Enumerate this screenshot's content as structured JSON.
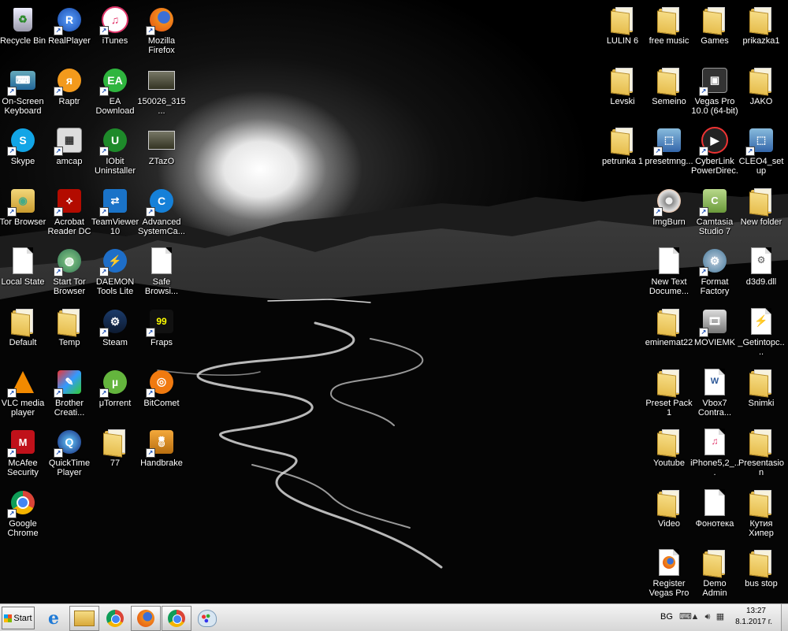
{
  "desktop": {
    "left_icons": [
      {
        "label": "Recycle Bin",
        "icon": "recycle-bin-icon"
      },
      {
        "label": "RealPlayer",
        "icon": "realplayer-icon"
      },
      {
        "label": "iTunes",
        "icon": "itunes-icon"
      },
      {
        "label": "Mozilla Firefox",
        "icon": "firefox-icon"
      },
      {
        "label": "On-Screen Keyboard",
        "icon": "keyboard-icon"
      },
      {
        "label": "Raptr",
        "icon": "raptr-icon"
      },
      {
        "label": "EA Download Manager",
        "icon": "ea-icon"
      },
      {
        "label": "150026_315...",
        "icon": "image-file-icon"
      },
      {
        "label": "Skype",
        "icon": "skype-icon"
      },
      {
        "label": "amcap",
        "icon": "amcap-icon"
      },
      {
        "label": "IObit Uninstaller",
        "icon": "iobit-icon"
      },
      {
        "label": "ZTazO",
        "icon": "image-file-icon"
      },
      {
        "label": "Tor Browser",
        "icon": "tor-icon"
      },
      {
        "label": "Acrobat Reader DC",
        "icon": "acrobat-icon"
      },
      {
        "label": "TeamViewer 10",
        "icon": "teamviewer-icon"
      },
      {
        "label": "Advanced SystemCa...",
        "icon": "advanced-systemcare-icon"
      },
      {
        "label": "Local State",
        "icon": "document-icon"
      },
      {
        "label": "Start Tor Browser",
        "icon": "tor-globe-icon"
      },
      {
        "label": "DAEMON Tools Lite",
        "icon": "daemon-tools-icon"
      },
      {
        "label": "Safe Browsi...",
        "icon": "document-icon"
      },
      {
        "label": "Default",
        "icon": "folder-icon"
      },
      {
        "label": "Temp",
        "icon": "folder-icon"
      },
      {
        "label": "Steam",
        "icon": "steam-icon"
      },
      {
        "label": "Fraps",
        "icon": "fraps-icon"
      },
      {
        "label": "VLC media player",
        "icon": "vlc-icon"
      },
      {
        "label": "Brother Creati...",
        "icon": "brother-icon"
      },
      {
        "label": "μTorrent",
        "icon": "utorrent-icon"
      },
      {
        "label": "BitComet",
        "icon": "bitcomet-icon"
      },
      {
        "label": "McAfee Security Sc...",
        "icon": "mcafee-icon"
      },
      {
        "label": "QuickTime Player",
        "icon": "quicktime-icon"
      },
      {
        "label": "77",
        "icon": "folder-icon"
      },
      {
        "label": "Handbrake",
        "icon": "handbrake-icon"
      },
      {
        "label": "Google Chrome",
        "icon": "chrome-icon"
      }
    ],
    "right_icons": [
      {
        "label": "LULIN 6",
        "icon": "folder-icon"
      },
      {
        "label": "free music",
        "icon": "folder-icon"
      },
      {
        "label": "Games",
        "icon": "folder-icon"
      },
      {
        "label": "prikazka1",
        "icon": "folder-icon"
      },
      {
        "label": "Levski",
        "icon": "folder-icon"
      },
      {
        "label": "Semeino",
        "icon": "folder-icon"
      },
      {
        "label": "Vegas Pro 10.0 (64-bit)",
        "icon": "vegas-icon"
      },
      {
        "label": "JAKO",
        "icon": "folder-icon"
      },
      {
        "label": "petrunka 1",
        "icon": "folder-icon"
      },
      {
        "label": "presetmng...",
        "icon": "installer-icon"
      },
      {
        "label": "CyberLink PowerDirec...",
        "icon": "powerdirector-icon"
      },
      {
        "label": "CLEO4_setup",
        "icon": "installer-icon"
      },
      {
        "label": "ImgBurn",
        "icon": "imgburn-icon"
      },
      {
        "label": "Camtasia Studio 7",
        "icon": "camtasia-icon"
      },
      {
        "label": "New folder",
        "icon": "folder-icon"
      },
      {
        "label": "New Text Docume...",
        "icon": "text-document-icon"
      },
      {
        "label": "Format Factory",
        "icon": "format-factory-icon"
      },
      {
        "label": "d3d9.dll",
        "icon": "dll-icon"
      },
      {
        "label": "eminemat22",
        "icon": "folder-icon"
      },
      {
        "label": "MOVIEMK",
        "icon": "moviemaker-icon"
      },
      {
        "label": "_Getintopc....",
        "icon": "getintopc-icon"
      },
      {
        "label": "Preset Pack 1",
        "icon": "folder-icon"
      },
      {
        "label": "Vbox7 Contra...",
        "icon": "word-document-icon"
      },
      {
        "label": "Snimki",
        "icon": "folder-icon"
      },
      {
        "label": "Youtube",
        "icon": "folder-icon"
      },
      {
        "label": "iPhone5,2_...",
        "icon": "ipsw-icon"
      },
      {
        "label": "Presentasion",
        "icon": "folder-icon"
      },
      {
        "label": "Video",
        "icon": "folder-icon"
      },
      {
        "label": "Фонотека",
        "icon": "document-icon"
      },
      {
        "label": "Кутия Хипер",
        "icon": "folder-icon"
      },
      {
        "label": "Register Vegas Pro",
        "icon": "firefox-doc-icon"
      },
      {
        "label": "Demo Admin",
        "icon": "folder-icon"
      },
      {
        "label": "bus stop",
        "icon": "folder-icon"
      }
    ]
  },
  "taskbar": {
    "start_label": "Start",
    "pinned": [
      {
        "icon": "internet-explorer-icon"
      },
      {
        "icon": "file-explorer-icon"
      },
      {
        "icon": "chrome-icon"
      },
      {
        "icon": "firefox-icon"
      },
      {
        "icon": "chrome-icon"
      },
      {
        "icon": "paint-icon"
      }
    ],
    "language": "BG",
    "time": "13:27",
    "date": "8.1.2017 г."
  }
}
